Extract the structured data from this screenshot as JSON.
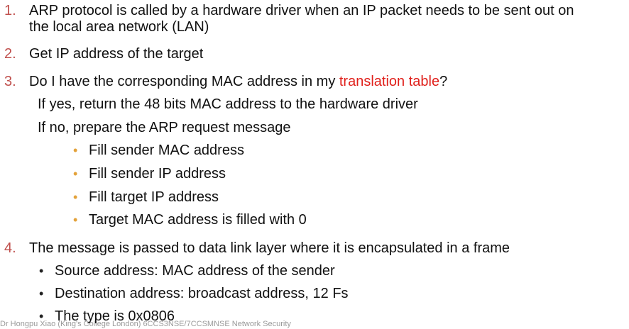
{
  "items": [
    {
      "number": "1.",
      "line1": "ARP protocol is called by a hardware driver when an IP packet needs to be sent out on",
      "line2": "the local area network (LAN)"
    },
    {
      "number": "2.",
      "text": "Get IP address of the target"
    },
    {
      "number": "3.",
      "text_before": "Do I have the corresponding MAC address in my ",
      "highlight": "translation table",
      "text_after": "?",
      "sub": [
        "If yes, return the 48 bits MAC address to the hardware driver",
        "If no, prepare the ARP request message"
      ],
      "bullets": [
        "Fill sender MAC address",
        "Fill sender IP address",
        "Fill target IP address",
        "Target MAC address is filled with 0"
      ]
    },
    {
      "number": "4.",
      "text": "The message is passed to data link layer where it is encapsulated in a frame",
      "bullets": [
        "Source address: MAC address of the sender",
        "Destination address: broadcast address, 12 Fs",
        "The type is 0x0806"
      ]
    }
  ],
  "bullet_char": "•",
  "footer": "Dr Hongpu Xiao (King's College London) 6CCS3NSE/7CCSMNSE Network Security",
  "colors": {
    "number": "#c0504d",
    "highlight": "#e0201b",
    "bullet_level1": "#e3a23a",
    "bullet_level2": "#222222"
  }
}
